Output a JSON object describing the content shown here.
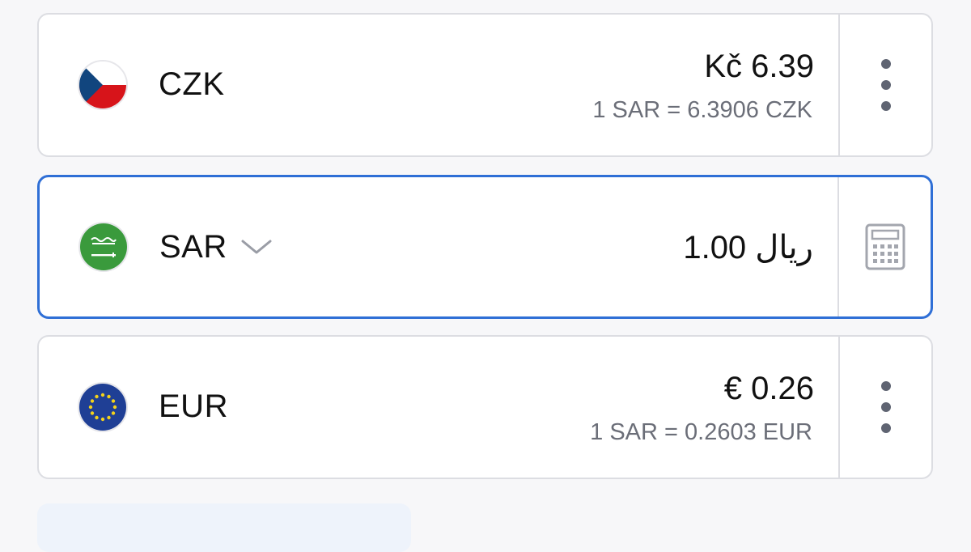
{
  "colors": {
    "accent": "#2f6fd6",
    "text": "#111111",
    "muted": "#6b6e78",
    "border": "#dcdde2"
  },
  "currencies": [
    {
      "code": "CZK",
      "flag_icon": "czech-flag-icon",
      "amount": "Kč 6.39",
      "rate": "1 SAR = 6.3906 CZK",
      "action_icon": "more-vertical-icon",
      "selected": false
    },
    {
      "code": "SAR",
      "flag_icon": "saudi-flag-icon",
      "amount": "1.00 ريال",
      "rate": "",
      "action_icon": "calculator-icon",
      "selected": true
    },
    {
      "code": "EUR",
      "flag_icon": "eu-flag-icon",
      "amount": "€ 0.26",
      "rate": "1 SAR = 0.2603 EUR",
      "action_icon": "more-vertical-icon",
      "selected": false
    }
  ]
}
